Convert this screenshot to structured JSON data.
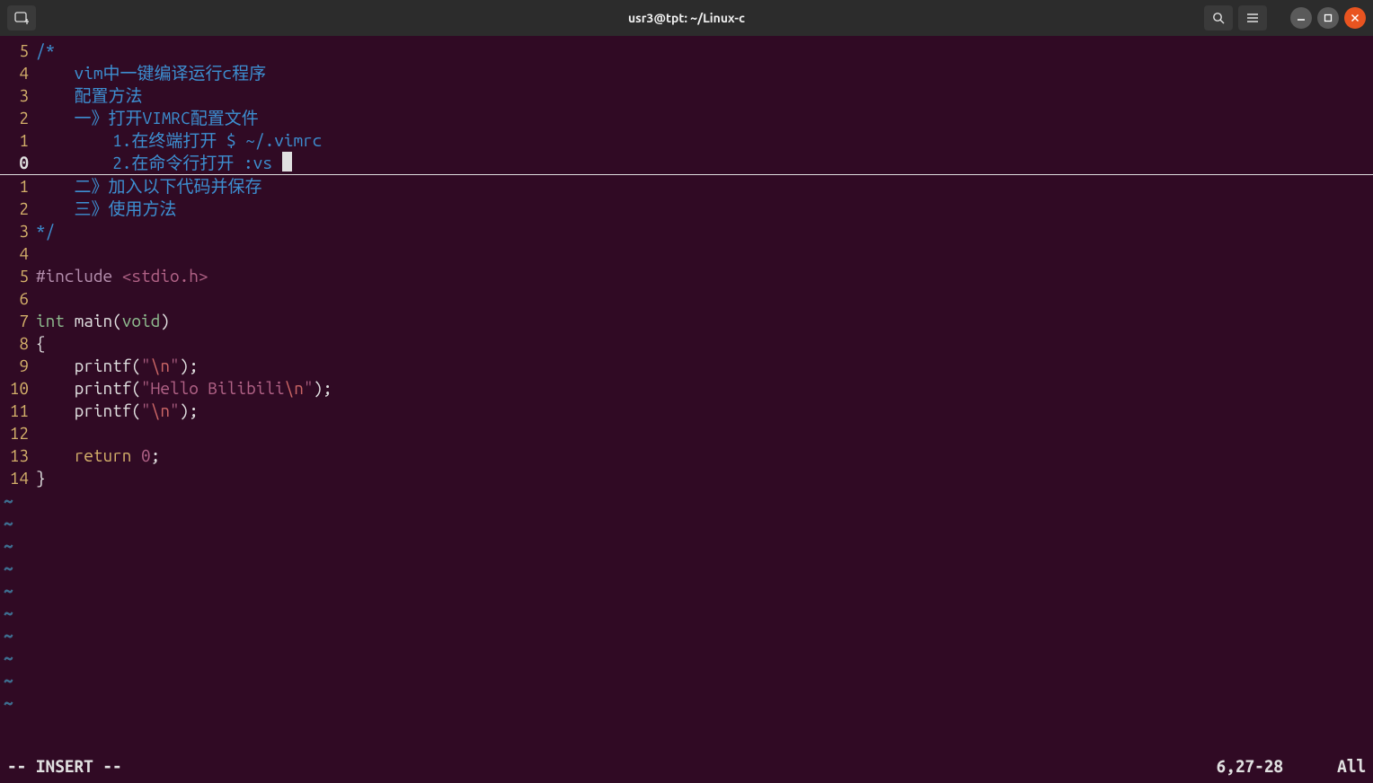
{
  "titlebar": {
    "title": "usr3@tpt: ~/Linux-c"
  },
  "gutter": {
    "l0": "5",
    "l1": "4",
    "l2": "3",
    "l3": "2",
    "l4": "1",
    "l5": "0",
    "l6": "1",
    "l7": "2",
    "l8": "3",
    "l9": "4",
    "l10": "5",
    "l11": "6",
    "l12": "7",
    "l13": "8",
    "l14": "9",
    "l15": "10",
    "l16": "11",
    "l17": "12",
    "l18": "13",
    "l19": "14"
  },
  "code": {
    "l0": {
      "raw": "/*"
    },
    "l1": {
      "a": "    vim中一键编译运行c程序"
    },
    "l2": {
      "a": "    配置方法"
    },
    "l3": {
      "a": "    一》打开VIMRC配置文件"
    },
    "l4": {
      "a": "        1.在终端打开 $ ~/.vimrc"
    },
    "l5": {
      "a": "        2.在命令行打开 :vs "
    },
    "l6": {
      "a": "    二》加入以下代码并保存"
    },
    "l7": {
      "a": "    三》使用方法"
    },
    "l8": {
      "raw": "*/"
    },
    "l9": {
      "raw": ""
    },
    "l10": {
      "preproc": "#include ",
      "path": "<stdio.h>"
    },
    "l11": {
      "raw": ""
    },
    "l12": {
      "type_a": "int",
      "space_a": " ",
      "func": "main",
      "paren_a": "(",
      "type_b": "void",
      "paren_b": ")"
    },
    "l13": {
      "raw": "{"
    },
    "l14": {
      "indent": "    ",
      "func": "printf",
      "paren_a": "(",
      "str_a": "\"",
      "esc": "\\n",
      "str_b": "\"",
      "paren_b": ");"
    },
    "l15": {
      "indent": "    ",
      "func": "printf",
      "paren_a": "(",
      "str_a": "\"Hello Bilibili",
      "esc": "\\n",
      "str_b": "\"",
      "paren_b": ");"
    },
    "l16": {
      "indent": "    ",
      "func": "printf",
      "paren_a": "(",
      "str_a": "\"",
      "esc": "\\n",
      "str_b": "\"",
      "paren_b": ");"
    },
    "l17": {
      "raw": ""
    },
    "l18": {
      "indent": "    ",
      "kw": "return",
      "space": " ",
      "num": "0",
      "semi": ";"
    },
    "l19": {
      "raw": "}"
    }
  },
  "tilde": "~",
  "status": {
    "mode": "-- INSERT --",
    "pos": "6,27-28",
    "all": "All"
  }
}
